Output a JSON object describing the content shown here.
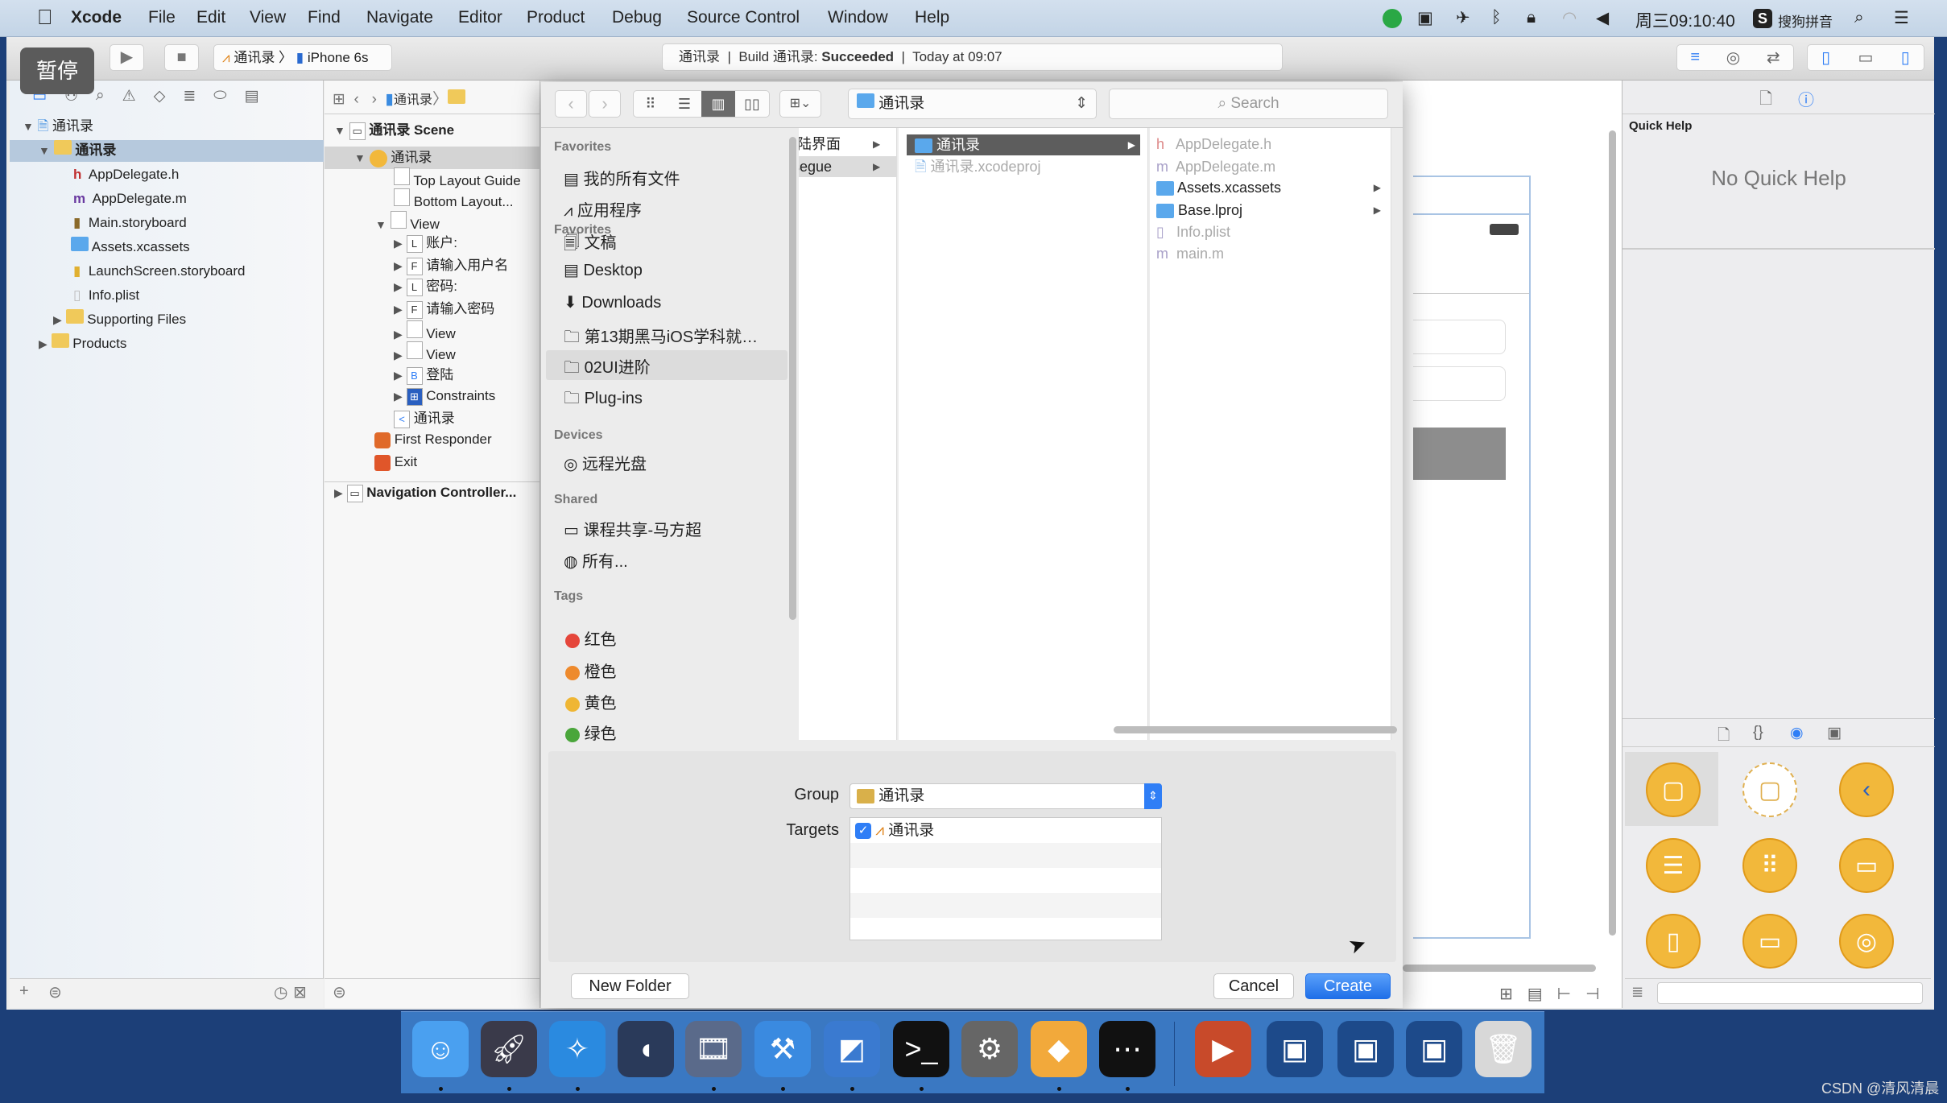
{
  "menubar": {
    "apple": "",
    "items": [
      "Xcode",
      "File",
      "Edit",
      "View",
      "Find",
      "Navigate",
      "Editor",
      "Product",
      "Debug",
      "Source Control",
      "Window",
      "Help"
    ],
    "clock": "周三09:10:40",
    "ime": "搜狗拼音"
  },
  "toolbar": {
    "pause_overlay": "暂停",
    "scheme": "通讯录",
    "device": "iPhone 6s",
    "activity": {
      "project": "通讯录",
      "build": "Build 通讯录:",
      "status": "Succeeded",
      "time": "Today at 09:07"
    }
  },
  "jumpbar": {
    "project": "通讯录"
  },
  "navigator": {
    "items": [
      {
        "label": "通讯录",
        "kind": "project"
      },
      {
        "label": "通讯录",
        "kind": "group"
      },
      {
        "label": "AppDelegate.h",
        "kind": "h"
      },
      {
        "label": "AppDelegate.m",
        "kind": "m"
      },
      {
        "label": "Main.storyboard",
        "kind": "sb"
      },
      {
        "label": "Assets.xcassets",
        "kind": "assets"
      },
      {
        "label": "LaunchScreen.storyboard",
        "kind": "sb"
      },
      {
        "label": "Info.plist",
        "kind": "plist"
      },
      {
        "label": "Supporting Files",
        "kind": "folder"
      },
      {
        "label": "Products",
        "kind": "folder"
      }
    ]
  },
  "outline": {
    "items": [
      {
        "label": "通讯录 Scene",
        "badge": ""
      },
      {
        "label": "通讯录",
        "badge": "●"
      },
      {
        "label": "Top Layout Guide",
        "badge": ""
      },
      {
        "label": "Bottom Layout...",
        "badge": ""
      },
      {
        "label": "View",
        "badge": ""
      },
      {
        "label": "账户:",
        "badge": "L"
      },
      {
        "label": "请输入用户名",
        "badge": "F"
      },
      {
        "label": "密码:",
        "badge": "L"
      },
      {
        "label": "请输入密码",
        "badge": "F"
      },
      {
        "label": "View",
        "badge": ""
      },
      {
        "label": "View",
        "badge": ""
      },
      {
        "label": "登陆",
        "badge": "B"
      },
      {
        "label": "Constraints",
        "badge": "⊞"
      },
      {
        "label": "通讯录",
        "badge": "<"
      },
      {
        "label": "First Responder",
        "badge": ""
      },
      {
        "label": "Exit",
        "badge": ""
      },
      {
        "label": "Navigation Controller...",
        "badge": ""
      }
    ]
  },
  "dialog": {
    "path_popup": "通讯录",
    "search_placeholder": "Search",
    "sidebar": {
      "favorites_header": "Favorites",
      "favorites": [
        "我的所有文件",
        "应用程序",
        "文稿",
        "Desktop",
        "Downloads",
        "第13期黑马iOS学科就…",
        "02UI进阶",
        "Plug-ins"
      ],
      "devices_header": "Devices",
      "devices": [
        "远程光盘"
      ],
      "shared_header": "Shared",
      "shared": [
        "课程共享-马方超",
        "所有..."
      ],
      "tags_header": "Tags",
      "tags": [
        {
          "label": "红色",
          "color": "#e5463b"
        },
        {
          "label": "橙色",
          "color": "#ee8a2d"
        },
        {
          "label": "黄色",
          "color": "#efb634"
        },
        {
          "label": "绿色",
          "color": "#4aa63b"
        }
      ]
    },
    "column1": [
      "登陆界面",
      "segue"
    ],
    "column2": [
      "通讯录",
      "通讯录.xcodeproj"
    ],
    "column3": [
      {
        "label": "AppDelegate.h",
        "icon": "h",
        "enabled": false
      },
      {
        "label": "AppDelegate.m",
        "icon": "m",
        "enabled": false
      },
      {
        "label": "Assets.xcassets",
        "icon": "folder",
        "enabled": true
      },
      {
        "label": "Base.lproj",
        "icon": "folder",
        "enabled": true
      },
      {
        "label": "Info.plist",
        "icon": "plist",
        "enabled": false
      },
      {
        "label": "main.m",
        "icon": "m",
        "enabled": false
      }
    ],
    "group_label": "Group",
    "group_value": "通讯录",
    "targets_label": "Targets",
    "targets": [
      {
        "label": "通讯录",
        "checked": true
      }
    ],
    "new_folder": "New Folder",
    "cancel": "Cancel",
    "create": "Create"
  },
  "inspector": {
    "title": "Quick Help",
    "empty": "No Quick Help"
  },
  "watermark": "CSDN @清风清晨",
  "colors": {
    "accent": "#2f7ef6",
    "selection": "#b6c9dd",
    "library": "#f2b83b"
  }
}
